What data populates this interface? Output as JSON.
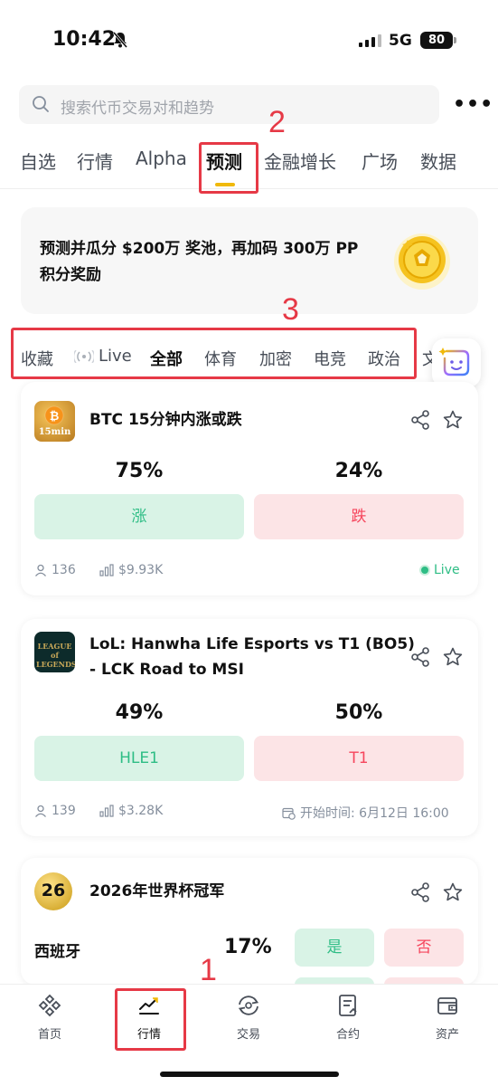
{
  "status_bar": {
    "time": "10:42",
    "network": "5G",
    "battery": "80"
  },
  "search": {
    "placeholder": "搜索代币交易对和趋势"
  },
  "main_tabs": [
    {
      "label": "自选"
    },
    {
      "label": "行情"
    },
    {
      "label": "Alpha"
    },
    {
      "label": "预测"
    },
    {
      "label": "金融增长"
    },
    {
      "label": "广场"
    },
    {
      "label": "数据"
    }
  ],
  "active_main_tab": "预测",
  "banner": {
    "text": "预测并瓜分 $200万 奖池，再加码 300万 PP积分奖励"
  },
  "sub_tabs": [
    {
      "label": "收藏"
    },
    {
      "label": "Live"
    },
    {
      "label": "全部"
    },
    {
      "label": "体育"
    },
    {
      "label": "加密"
    },
    {
      "label": "电竞"
    },
    {
      "label": "政治"
    },
    {
      "label": "文"
    }
  ],
  "active_sub_tab": "全部",
  "annotations": {
    "n1": "1",
    "n2": "2",
    "n3": "3"
  },
  "cards": [
    {
      "logo_text": "15min",
      "title": "BTC 15分钟内涨或跌",
      "yes_pct": "75%",
      "no_pct": "24%",
      "yes_label": "涨",
      "no_label": "跌",
      "users": "136",
      "volume": "$9.93K",
      "status": "Live"
    },
    {
      "logo_text": "LEAGUE of LEGENDS",
      "title_line1": "LoL: Hanwha Life Esports vs T1 (BO5)",
      "title_line2": "- LCK Road to MSI",
      "yes_pct": "49%",
      "no_pct": "50%",
      "yes_label": "HLE1",
      "no_label": "T1",
      "users": "139",
      "volume": "$3.28K",
      "start_time": "开始时间: 6月12日 16:00"
    },
    {
      "logo_text": "26",
      "title": "2026年世界杯冠军",
      "team": "西班牙",
      "team_pct": "17%",
      "yes_label": "是",
      "no_label": "否"
    }
  ],
  "bottom_nav": [
    {
      "label": "首页"
    },
    {
      "label": "行情"
    },
    {
      "label": "交易"
    },
    {
      "label": "合约"
    },
    {
      "label": "资产"
    }
  ],
  "colors": {
    "accent": "#f0b90b",
    "green": "#2ebd85",
    "red": "#f6465d",
    "annotation": "#e63946"
  }
}
